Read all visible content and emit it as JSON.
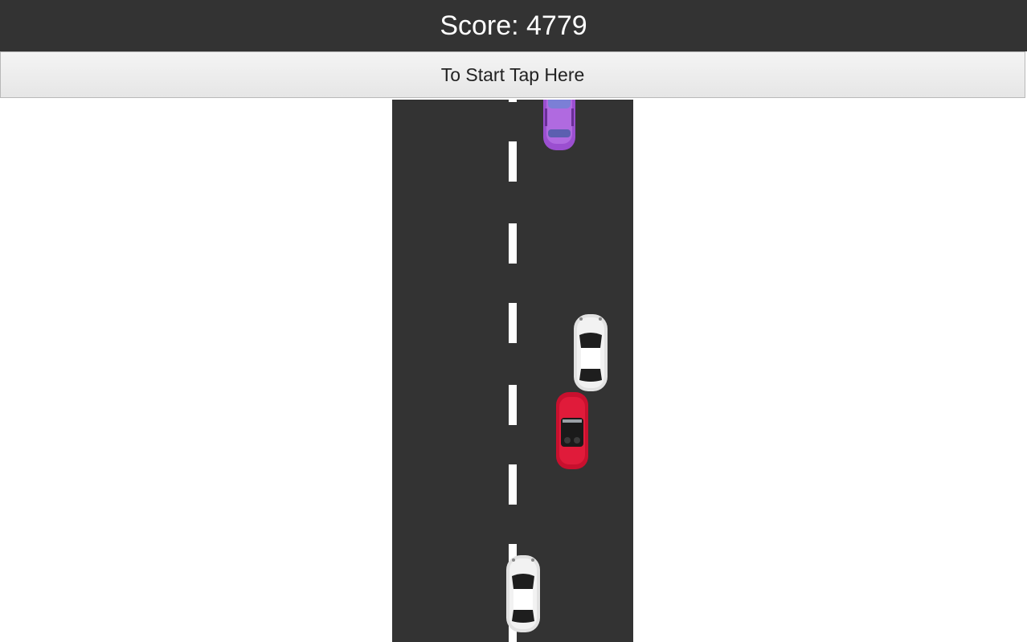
{
  "score": {
    "label": "Score:",
    "value": "4779",
    "text": "Score: 4779"
  },
  "start_button": {
    "label": "To Start Tap Here"
  },
  "road": {
    "color": "#333333",
    "lane_marking_color": "#ffffff"
  },
  "cars": [
    {
      "name": "purple-car",
      "color": "#9b4fd0",
      "role": "traffic"
    },
    {
      "name": "silver-car",
      "color": "#d8d8d8",
      "role": "traffic"
    },
    {
      "name": "red-convertible",
      "color": "#c8102e",
      "role": "traffic"
    },
    {
      "name": "player-car",
      "color": "#d8d8d8",
      "role": "player"
    }
  ]
}
